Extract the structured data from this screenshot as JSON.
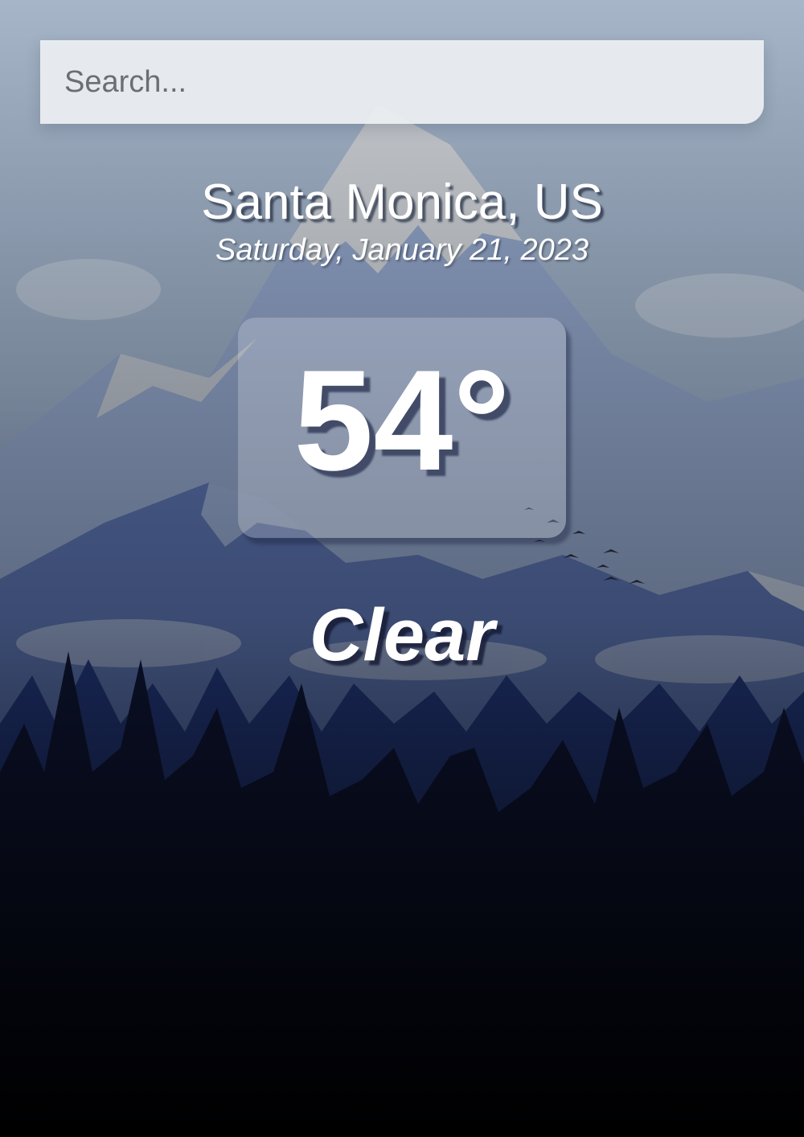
{
  "search": {
    "placeholder": "Search...",
    "value": ""
  },
  "weather": {
    "location": "Santa Monica, US",
    "date": "Saturday, January 21, 2023",
    "temperature": "54°",
    "condition": "Clear"
  },
  "background": {
    "icon": "mountain-forest-landscape",
    "sky_color": "#a9b8c8",
    "mountain_color": "#6f86b8",
    "forest_color": "#0b1230"
  }
}
